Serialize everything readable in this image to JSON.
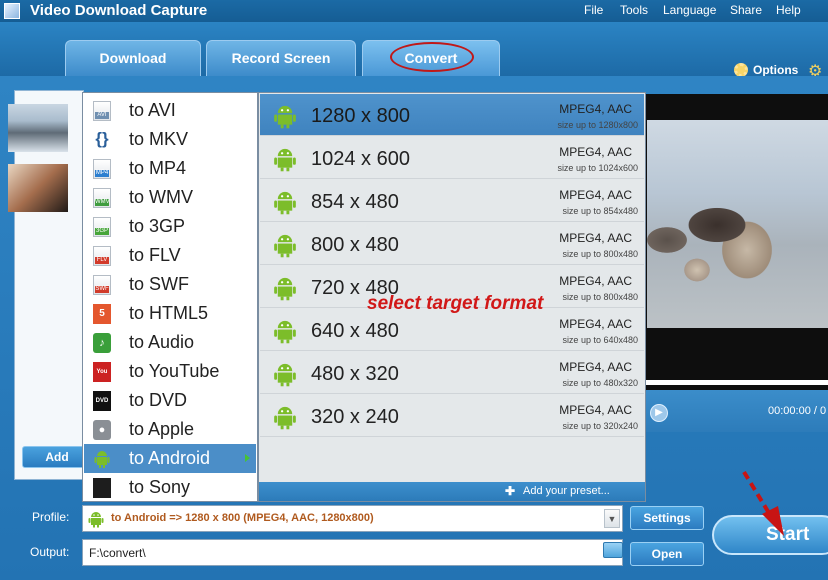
{
  "window": {
    "title": "Video Download Capture",
    "menu": [
      "File",
      "Tools",
      "Language",
      "Share",
      "Help"
    ]
  },
  "tabs": [
    {
      "label": "Download",
      "active": false
    },
    {
      "label": "Record Screen",
      "active": false
    },
    {
      "label": "Convert",
      "active": true
    }
  ],
  "options_label": "Options",
  "left_panel": {
    "add_label": "Add"
  },
  "formats": [
    {
      "label": "to AVI",
      "icon": "avi-file-icon",
      "tag": "AVI",
      "color": "#6f8fb0"
    },
    {
      "label": "to MKV",
      "icon": "mkv-braces-icon",
      "tag": "",
      "color": "#2a5f9a"
    },
    {
      "label": "to MP4",
      "icon": "mp4-file-icon",
      "tag": "MP4",
      "color": "#2c7fd0"
    },
    {
      "label": "to WMV",
      "icon": "wmv-file-icon",
      "tag": "WMV",
      "color": "#3f9c3f"
    },
    {
      "label": "to 3GP",
      "icon": "3gp-file-icon",
      "tag": "3GP",
      "color": "#47a53a"
    },
    {
      "label": "to FLV",
      "icon": "flv-file-icon",
      "tag": "FLV",
      "color": "#d23a2a"
    },
    {
      "label": "to SWF",
      "icon": "swf-file-icon",
      "tag": "SWF",
      "color": "#d13b2a"
    },
    {
      "label": "to HTML5",
      "icon": "html5-icon",
      "tag": "5",
      "color": "#e4572e"
    },
    {
      "label": "to Audio",
      "icon": "audio-note-icon",
      "tag": "",
      "color": "#3a9f3a"
    },
    {
      "label": "to YouTube",
      "icon": "youtube-icon",
      "tag": "You",
      "color": "#cc2222"
    },
    {
      "label": "to DVD",
      "icon": "dvd-icon",
      "tag": "DVD",
      "color": "#111111"
    },
    {
      "label": "to Apple",
      "icon": "apple-icon",
      "tag": "",
      "color": "#8a8f95"
    },
    {
      "label": "to Android",
      "icon": "android-icon",
      "tag": "",
      "color": "#7cbd2a",
      "selected": true
    },
    {
      "label": "to Sony",
      "icon": "playstation-icon",
      "tag": "",
      "color": "#1d1d1d"
    }
  ],
  "resolutions": [
    {
      "label": "1280 x 800",
      "codec": "MPEG4, AAC",
      "size": "size up to 1280x800",
      "selected": true
    },
    {
      "label": "1024 x 600",
      "codec": "MPEG4, AAC",
      "size": "size up to 1024x600"
    },
    {
      "label": "854 x 480",
      "codec": "MPEG4, AAC",
      "size": "size up to 854x480"
    },
    {
      "label": "800 x 480",
      "codec": "MPEG4, AAC",
      "size": "size up to 800x480"
    },
    {
      "label": "720 x 480",
      "codec": "MPEG4, AAC",
      "size": "size up to 800x480"
    },
    {
      "label": "640 x 480",
      "codec": "MPEG4, AAC",
      "size": "size up to 640x480"
    },
    {
      "label": "480 x 320",
      "codec": "MPEG4, AAC",
      "size": "size up to 480x320"
    },
    {
      "label": "320 x 240",
      "codec": "MPEG4, AAC",
      "size": "size up to 320x240"
    }
  ],
  "annotation": "select target format",
  "preset": {
    "label": "Add your preset..."
  },
  "player": {
    "time": "00:00:00 / 0"
  },
  "profile": {
    "label": "Profile:",
    "value": "to Android => 1280 x 800 (MPEG4, AAC, 1280x800)"
  },
  "output": {
    "label": "Output:",
    "value": "F:\\convert\\"
  },
  "buttons": {
    "settings": "Settings",
    "open": "Open",
    "start": "Start"
  },
  "colors": {
    "accent": "#2f84c4",
    "annotation": "#d11818",
    "android": "#7cbd2a"
  }
}
